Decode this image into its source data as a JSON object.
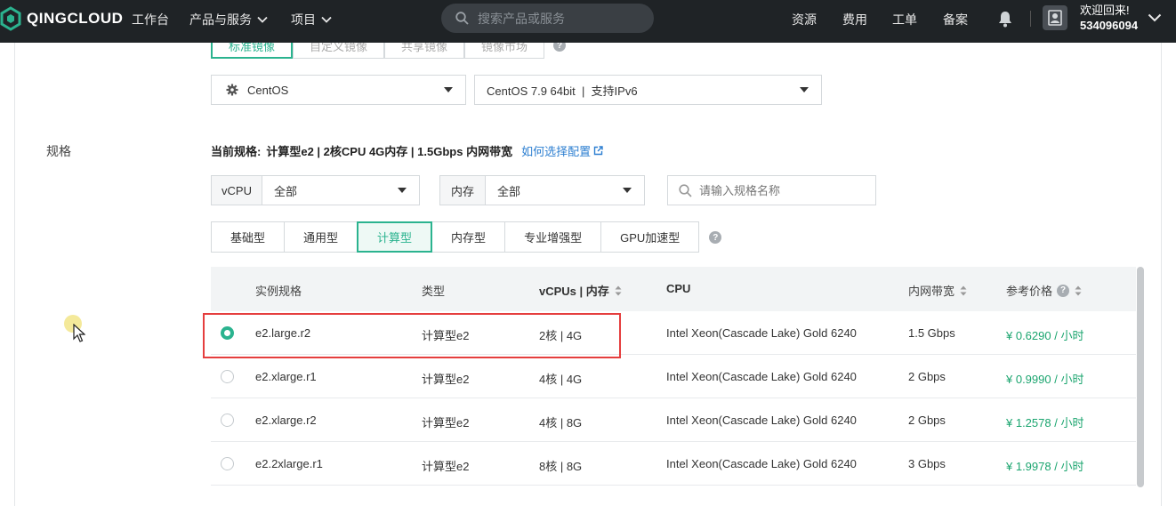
{
  "topbar": {
    "logo_text": "QINGCLOUD",
    "nav": [
      {
        "label": "工作台"
      },
      {
        "label": "产品与服务"
      },
      {
        "label": "项目"
      }
    ],
    "search_placeholder": "搜索产品或服务",
    "right_links": [
      "资源",
      "费用",
      "工单",
      "备案"
    ],
    "user_greeting": "欢迎回来!",
    "user_id": "534096094",
    "icons": {
      "logo": "qingcloud-logo-icon",
      "search": "search-icon",
      "bell": "bell-icon",
      "user": "user-avatar-icon",
      "chevron": "chevron-down-icon"
    }
  },
  "image_tabs": [
    "标准镜像",
    "自定义镜像",
    "共享镜像",
    "镜像市场"
  ],
  "os_select": {
    "value": "CentOS",
    "icon": "gear-icon"
  },
  "version_select": {
    "value": "CentOS 7.9 64bit  |  支持IPv6"
  },
  "spec": {
    "section_label": "规格",
    "current_prefix": "当前规格:",
    "current_value": "计算型e2 | 2核CPU 4G内存 | 1.5Gbps 内网带宽",
    "help_link": "如何选择配置",
    "vcpu_label": "vCPU",
    "vcpu_value": "全部",
    "mem_label": "内存",
    "mem_value": "全部",
    "search_placeholder": "请输入规格名称",
    "type_tabs": [
      "基础型",
      "通用型",
      "计算型",
      "内存型",
      "专业增强型",
      "GPU加速型"
    ],
    "active_type": "计算型"
  },
  "table": {
    "headers": {
      "name": "实例规格",
      "type": "类型",
      "vcpu_mem": "vCPUs | 内存",
      "cpu": "CPU",
      "bandwidth": "内网带宽",
      "price": "参考价格"
    },
    "rows": [
      {
        "name": "e2.large.r2",
        "type": "计算型e2",
        "vcpu_mem": "2核 | 4G",
        "cpu": "Intel Xeon(Cascade Lake) Gold 6240",
        "bandwidth": "1.5 Gbps",
        "price": "¥ 0.6290 / 小时",
        "selected": true
      },
      {
        "name": "e2.xlarge.r1",
        "type": "计算型e2",
        "vcpu_mem": "4核 | 4G",
        "cpu": "Intel Xeon(Cascade Lake) Gold 6240",
        "bandwidth": "2 Gbps",
        "price": "¥ 0.9990 / 小时",
        "selected": false
      },
      {
        "name": "e2.xlarge.r2",
        "type": "计算型e2",
        "vcpu_mem": "4核 | 8G",
        "cpu": "Intel Xeon(Cascade Lake) Gold 6240",
        "bandwidth": "2 Gbps",
        "price": "¥ 1.2578 / 小时",
        "selected": false
      },
      {
        "name": "e2.2xlarge.r1",
        "type": "计算型e2",
        "vcpu_mem": "8核 | 8G",
        "cpu": "Intel Xeon(Cascade Lake) Gold 6240",
        "bandwidth": "3 Gbps",
        "price": "¥ 1.9978 / 小时",
        "selected": false
      }
    ]
  },
  "colors": {
    "accent": "#2bb38f",
    "price": "#1ba56f",
    "link": "#2d7fd1",
    "highlight": "#e53e3e",
    "topbar": "#1f2326"
  }
}
